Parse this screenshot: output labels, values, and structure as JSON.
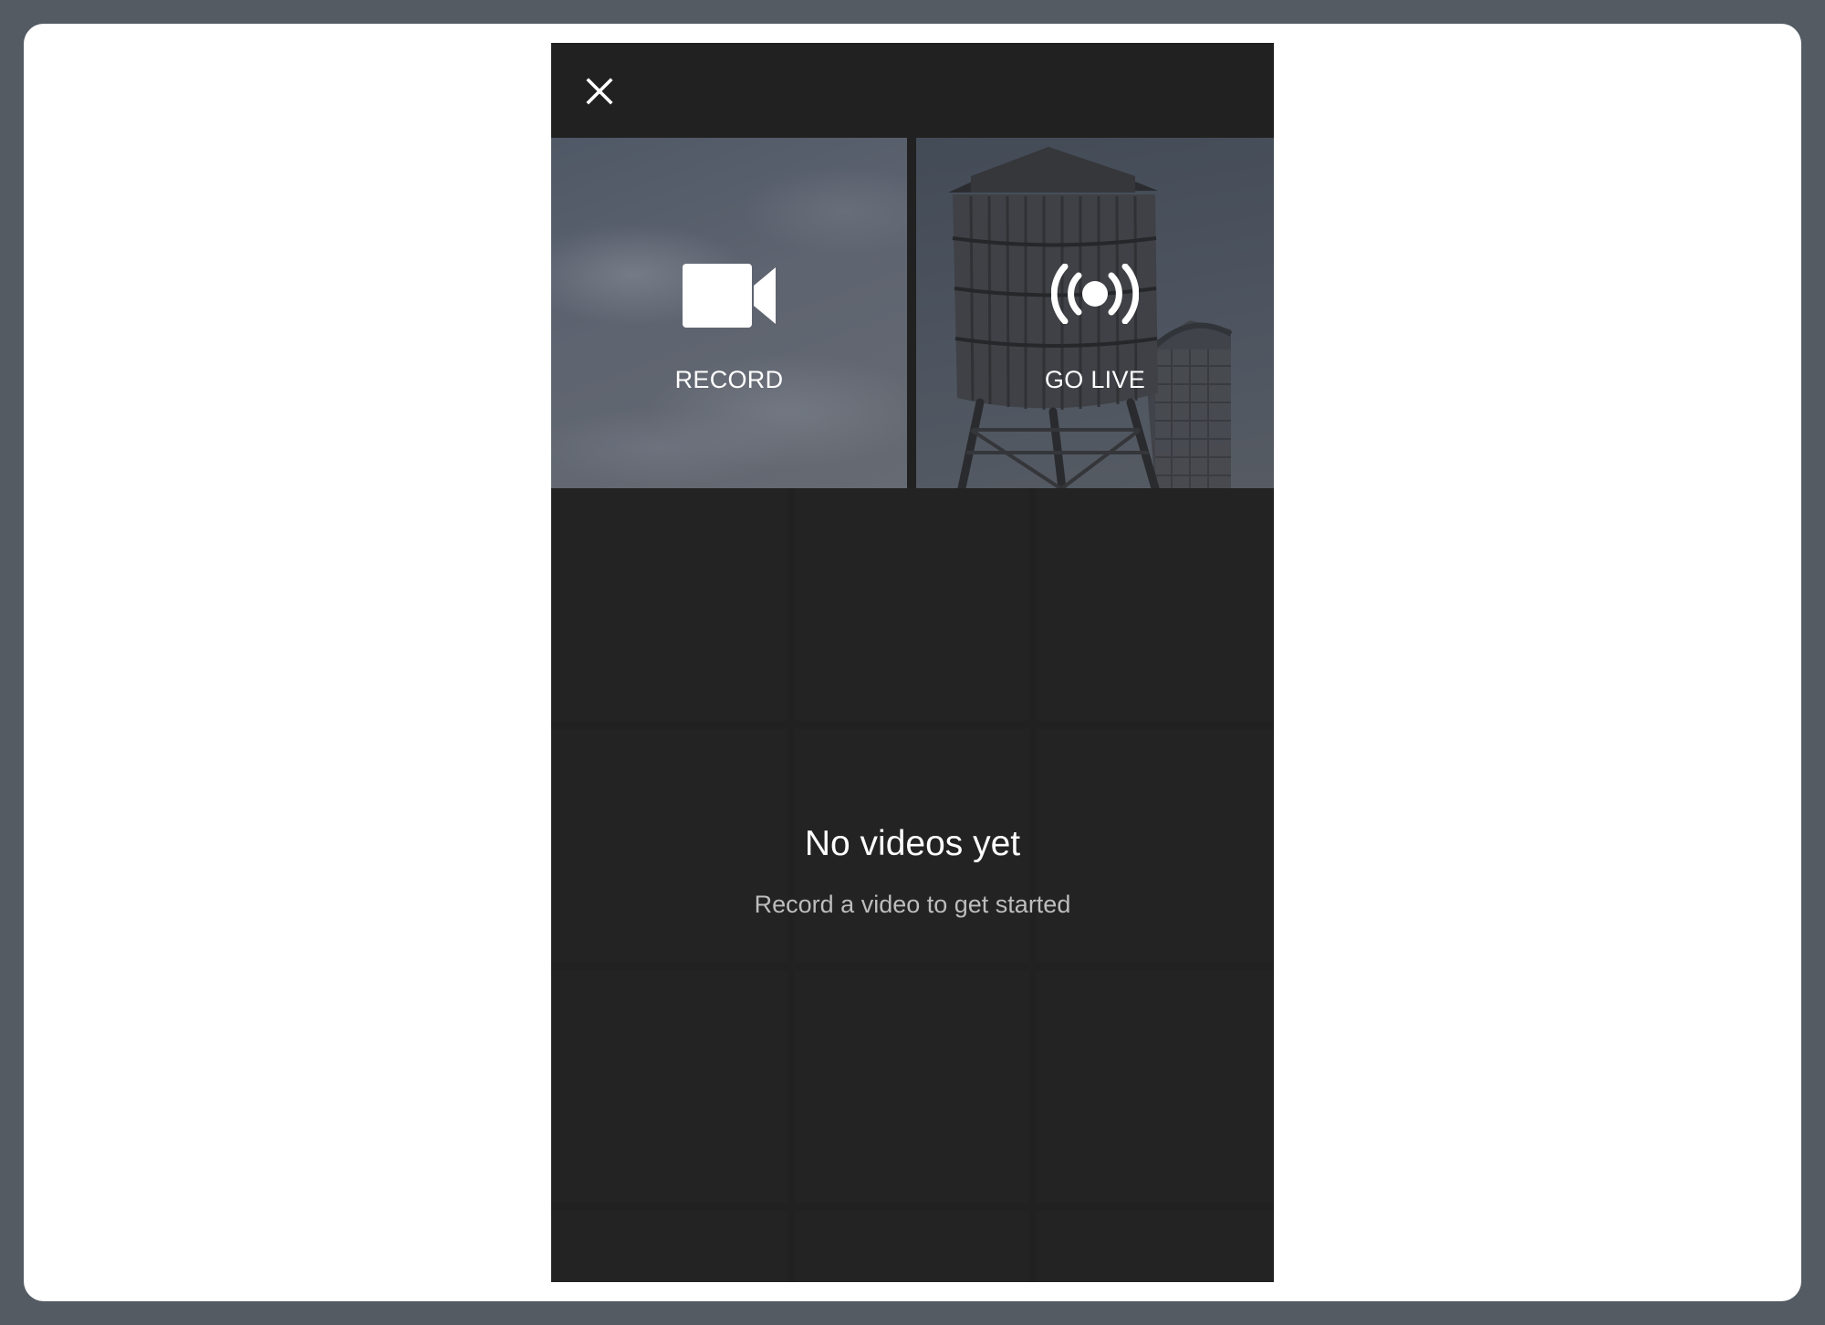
{
  "header": {
    "close_icon": "close-icon"
  },
  "create_options": [
    {
      "label": "RECORD",
      "icon": "video-camera-icon"
    },
    {
      "label": "GO LIVE",
      "icon": "live-broadcast-icon"
    }
  ],
  "empty_state": {
    "title": "No videos yet",
    "subtitle": "Record a video to get started"
  },
  "colors": {
    "outer_frame": "#545b63",
    "panel_background": "#ffffff",
    "app_background": "#212121",
    "grid_cell": "#232323",
    "text_primary": "#ffffff",
    "text_secondary": "#bdbdbd"
  }
}
